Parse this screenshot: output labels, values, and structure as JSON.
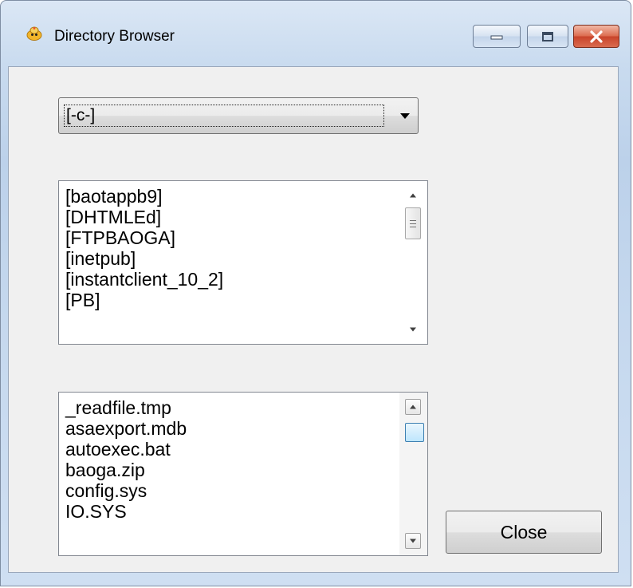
{
  "window": {
    "title": "Directory Browser",
    "accent": "#c8432a"
  },
  "drive_combo": {
    "selected": "[-c-]"
  },
  "directory_list": {
    "items": [
      "[baotappb9]",
      "[DHTMLEd]",
      "[FTPBAOGA]",
      "[inetpub]",
      "[instantclient_10_2]",
      "[PB]"
    ]
  },
  "file_list": {
    "items": [
      "_readfile.tmp",
      "asaexport.mdb",
      "autoexec.bat",
      "baoga.zip",
      "config.sys",
      "IO.SYS"
    ]
  },
  "buttons": {
    "close_label": "Close"
  },
  "icons": {
    "app": "face-icon",
    "minimize": "minimize-icon",
    "maximize": "maximize-icon",
    "close": "close-x-icon"
  }
}
